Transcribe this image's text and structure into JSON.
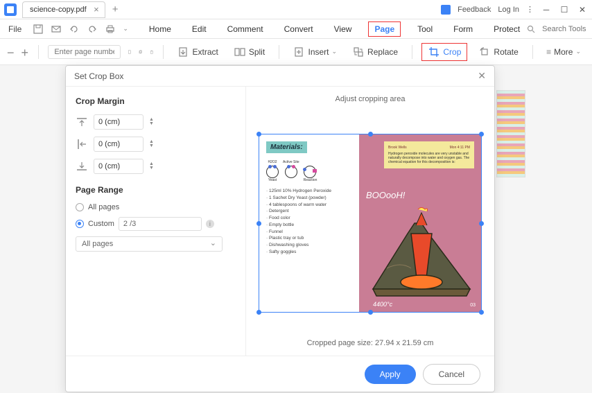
{
  "titlebar": {
    "tab_name": "science-copy.pdf",
    "feedback": "Feedback",
    "login": "Log In"
  },
  "menubar": {
    "file": "File",
    "tabs": [
      "Home",
      "Edit",
      "Comment",
      "Convert",
      "View",
      "Page",
      "Tool",
      "Form",
      "Protect"
    ],
    "active_tab_index": 5,
    "search_placeholder": "Search Tools"
  },
  "toolbar": {
    "page_placeholder": "Enter page number",
    "extract": "Extract",
    "split": "Split",
    "insert": "Insert",
    "replace": "Replace",
    "crop": "Crop",
    "rotate": "Rotate",
    "more": "More"
  },
  "dialog": {
    "title": "Set Crop Box",
    "crop_margin_label": "Crop Margin",
    "margin_top": "0 (cm)",
    "margin_left": "0 (cm)",
    "margin_bottom": "0 (cm)",
    "page_range_label": "Page Range",
    "all_pages": "All pages",
    "custom": "Custom",
    "custom_value": "2 /3",
    "all_pages_select": "All pages",
    "preview_title": "Adjust cropping area",
    "size_text": "Cropped page size: 27.94 x 21.59 cm",
    "apply": "Apply",
    "cancel": "Cancel"
  },
  "page_preview": {
    "materials_header": "Materials:",
    "chem": {
      "h2o2": "H2O2",
      "yeast": "Yeast",
      "active_site": "Active Site",
      "reaction": "Reaction"
    },
    "materials": [
      "125ml 10% Hydrogen Peroxide",
      "1 Sachet Dry Yeast (powder)",
      "4 tablespoons of warm water",
      "Detergent",
      "Food color",
      "Empty bottle",
      "Funnel",
      "Plastic tray or tub",
      "Dishwashing gloves",
      "Safty goggles"
    ],
    "note": {
      "author": "Brook Wells",
      "time": "Mon 4:11 PM",
      "text": "Hydrogen peroxide molecules are very unstable and naturally decompose into water and oxygen gas. The chemical equation for this decomposition is:"
    },
    "boo_text": "BOOooH!",
    "temperature": "4400°c",
    "page_num": "03"
  }
}
